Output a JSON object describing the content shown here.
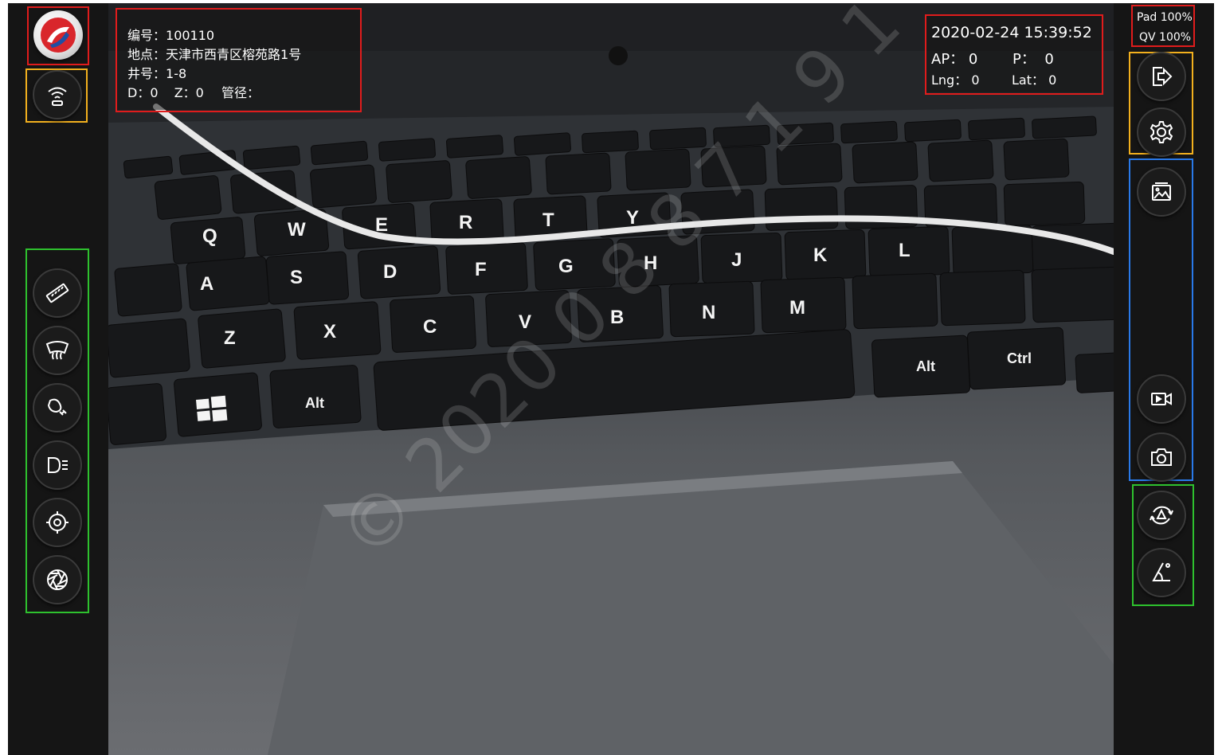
{
  "info": {
    "id_label": "编号：",
    "id_value": "100110",
    "location_label": "地点：",
    "location_value": "天津市西青区榕苑路1号",
    "well_label": "井号：",
    "well_value": "1-8",
    "d_label": "D：",
    "d_value": "0",
    "z_label": "Z：",
    "z_value": "0",
    "pipe_label": "管径："
  },
  "status": {
    "datetime": "2020-02-24 15:39:52",
    "ap_label": "AP：",
    "ap_value": "0",
    "p_label": "P：",
    "p_value": "0",
    "lng_label": "Lng：",
    "lng_value": "0",
    "lat_label": "Lat：",
    "lat_value": "0"
  },
  "battery": {
    "pad": "Pad 100%",
    "qv": "QV 100%"
  },
  "left_toolbar": {
    "items": [
      "logo",
      "wifi-icon",
      "ruler-icon",
      "defog-icon",
      "light-icon",
      "headlight-icon",
      "focus-icon",
      "aperture-icon"
    ]
  },
  "right_toolbar": {
    "items": [
      "exit-icon",
      "settings-icon",
      "gallery-icon",
      "video-record-icon",
      "camera-icon",
      "rotate-icon",
      "angle-icon"
    ]
  },
  "colors": {
    "highlight_red": "#e01c1c",
    "highlight_yellow": "#f2b01e",
    "highlight_green": "#2ec12e",
    "highlight_blue": "#2979e8",
    "logo_red": "#d9262b",
    "logo_blue": "#1f4fa3"
  }
}
